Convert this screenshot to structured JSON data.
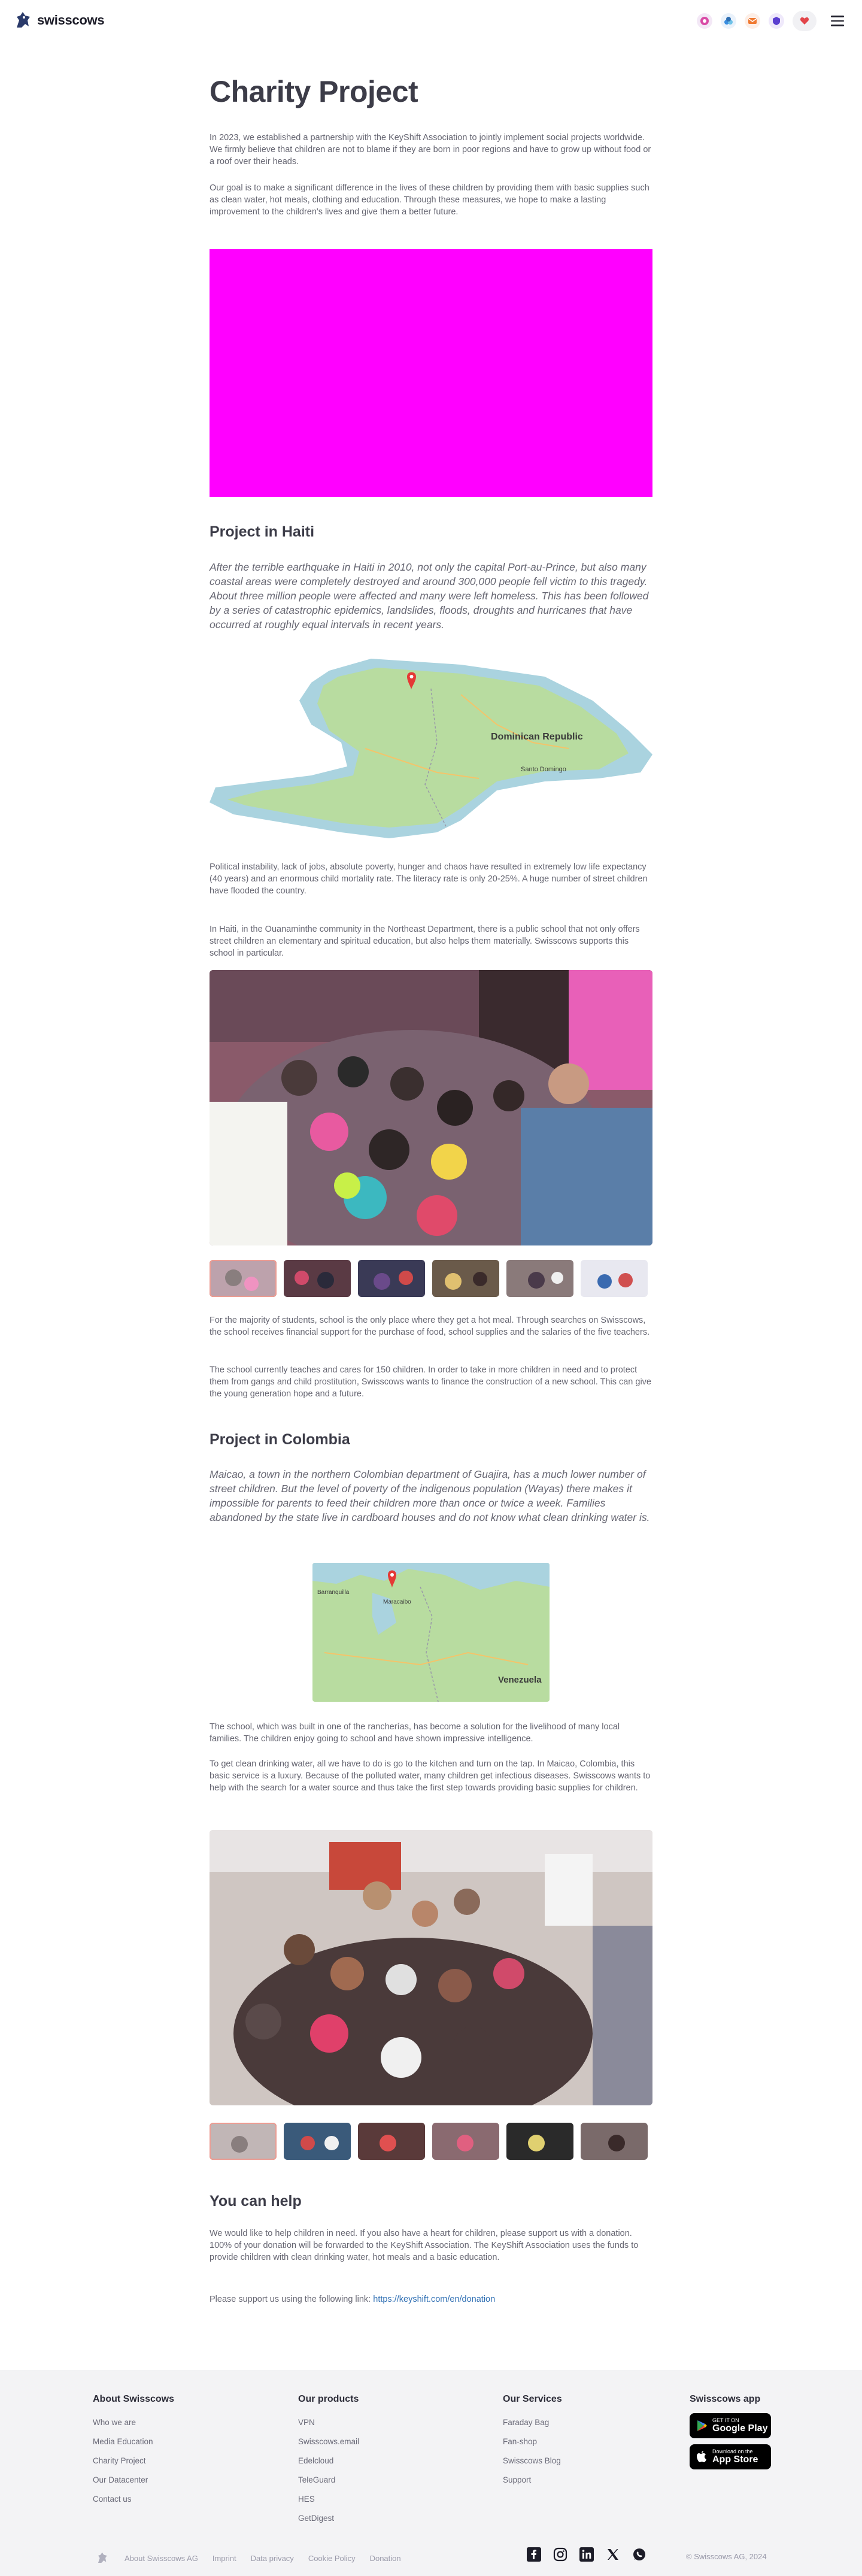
{
  "header": {
    "brand": "swisscows",
    "icons": [
      "messenger-icon",
      "vpn-icon",
      "email-icon",
      "teleguard-icon",
      "heart-icon",
      "menu-icon"
    ]
  },
  "page": {
    "title": "Charity Project",
    "intro_1": "In 2023, we established a partnership with the KeyShift Association to jointly implement social projects worldwide. We firmly believe that children are not to blame if they are born in poor regions and have to grow up without food or a roof over their heads.",
    "intro_2": "Our goal is to make a significant difference in the lives of these children by providing them with basic supplies such as clean water, hot meals, clothing and education. Through these measures, we hope to make a lasting improvement to the children's lives and give them a better future."
  },
  "haiti": {
    "heading": "Project in Haiti",
    "lead": "After the terrible earthquake in Haiti in 2010, not only the capital Port-au-Prince, but also many coastal areas were completely destroyed and around 300,000 people fell victim to this tragedy. About three million people were affected and many were left homeless. This has been followed by a series of catastrophic epidemics, landslides, floods, droughts and hurricanes that have occurred at roughly equal intervals in recent years.",
    "map_label": "Dominican Republic",
    "map_city": "Santo Domingo",
    "para_1": "Political instability, lack of jobs, absolute poverty, hunger and chaos have resulted in extremely low life expectancy (40 years) and an enormous child mortality rate. The literacy rate is only 20-25%. A huge number of street children have flooded the country.",
    "para_2": "In Haiti, in the Ouanaminthe community in the Northeast Department, there is a public school that not only offers street children an elementary and spiritual education, but also helps them materially. Swisscows supports this school in particular.",
    "para_3": "For the majority of students, school is the only place where they get a hot meal. Through searches on Swisscows, the school receives financial support for the purchase of food, school supplies and the salaries of the five teachers.",
    "para_4": "The school currently teaches and cares for 150 children. In order to take in more children in need and to protect them from gangs and child prostitution, Swisscows wants to finance the construction of a new school. This can give the young generation hope and a future."
  },
  "colombia": {
    "heading": "Project in Colombia",
    "lead": "Maicao, a town in the northern Colombian department of Guajira, has a much lower number of street children. But the level of poverty of the indigenous population (Wayas) there makes it impossible for parents to feed their children more than once or twice a week. Families abandoned by the state live in cardboard houses and do not know what clean drinking water is.",
    "map_label": "Venezuela",
    "map_city": "Barranquilla",
    "map_city_2": "Maracaibo",
    "para_1": "The school, which was built in one of the rancherías, has become a solution for the livelihood of many local families. The children enjoy going to school and have shown impressive intelligence.",
    "para_2": "To get clean drinking water, all we have to do is go to the kitchen and turn on the tap. In Maicao, Colombia, this basic service is a luxury. Because of the polluted water, many children get infectious diseases. Swisscows wants to help with the search for a water source and thus take the first step towards providing basic supplies for children."
  },
  "help": {
    "heading": "You can help",
    "para_1": "We would like to help children in need. If you also have a heart for children, please support us with a donation. 100% of your donation will be forwarded to the KeyShift Association. The KeyShift Association uses the funds to provide children with clean drinking water, hot meals and a basic education.",
    "para_2_prefix": "Please support us using the following link: ",
    "link": "https://keyshift.com/en/donation"
  },
  "footer": {
    "about": {
      "title": "About Swisscows",
      "links": [
        "Who we are",
        "Media Education",
        "Charity Project",
        "Our Datacenter",
        "Contact us"
      ]
    },
    "products": {
      "title": "Our products",
      "links": [
        "VPN",
        "Swisscows.email",
        "Edelcloud",
        "TeleGuard",
        "HES",
        "GetDigest"
      ]
    },
    "services": {
      "title": "Our Services",
      "links": [
        "Faraday Bag",
        "Fan-shop",
        "Swisscows Blog",
        "Support"
      ]
    },
    "app": {
      "title": "Swisscows app",
      "google_small": "GET IT ON",
      "google_big": "Google Play",
      "apple_small": "Download on the",
      "apple_big": "App Store"
    },
    "bottom_links": [
      "About Swisscows AG",
      "Imprint",
      "Data privacy",
      "Cookie Policy",
      "Donation"
    ],
    "socials": [
      "facebook-icon",
      "instagram-icon",
      "linkedin-icon",
      "x-icon",
      "whatsapp-icon"
    ],
    "copyright": "© Swisscows AG, 2024"
  }
}
